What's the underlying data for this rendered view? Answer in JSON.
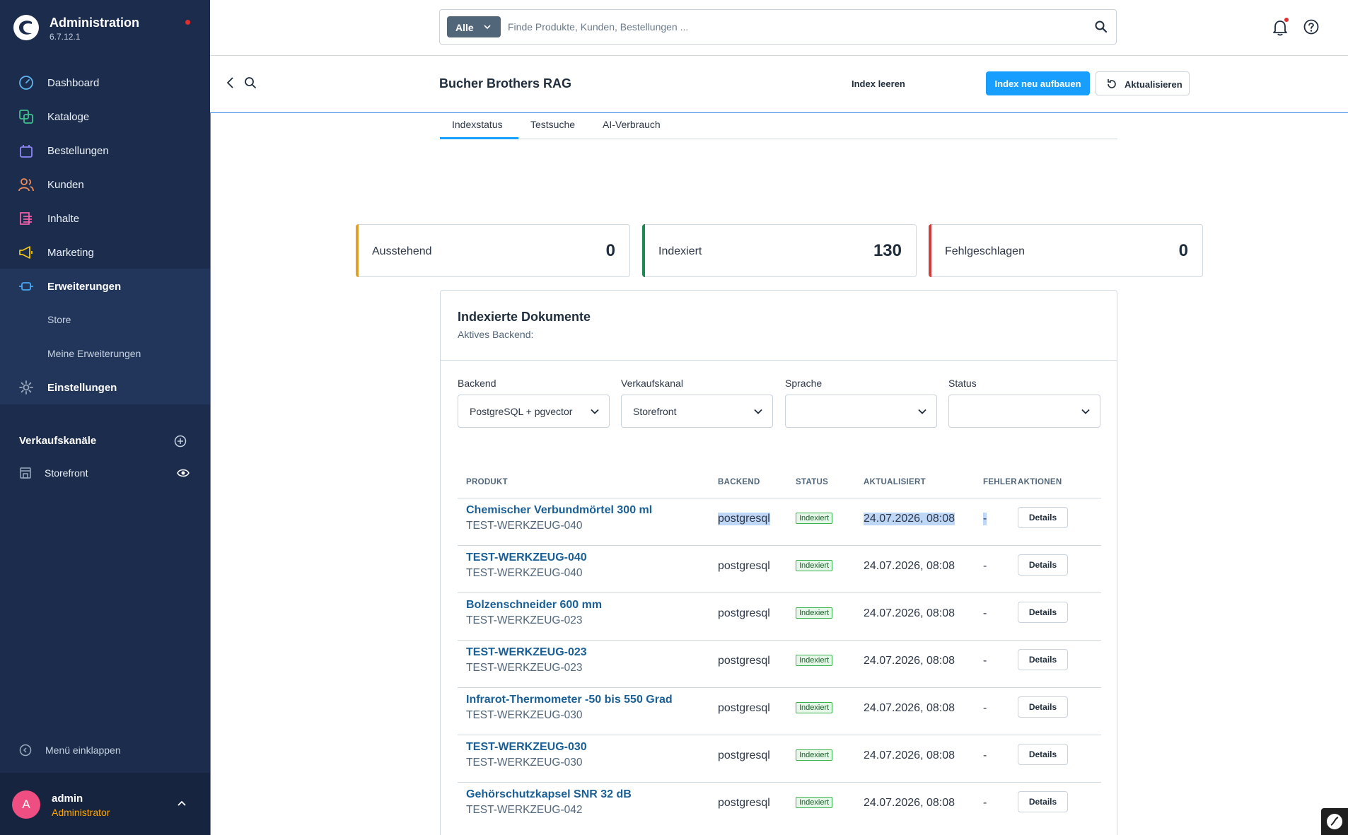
{
  "brand": {
    "title": "Administration",
    "version": "6.7.12.1"
  },
  "nav": {
    "items": [
      {
        "label": "Dashboard",
        "icon": "gauge-icon"
      },
      {
        "label": "Kataloge",
        "icon": "catalog-icon"
      },
      {
        "label": "Bestellungen",
        "icon": "shopping-bag-icon"
      },
      {
        "label": "Kunden",
        "icon": "users-icon"
      },
      {
        "label": "Inhalte",
        "icon": "content-icon"
      },
      {
        "label": "Marketing",
        "icon": "megaphone-icon"
      },
      {
        "label": "Erweiterungen",
        "icon": "plug-icon"
      },
      {
        "label": "Einstellungen",
        "icon": "gear-icon"
      }
    ],
    "sub_items": [
      "Store",
      "Meine Erweiterungen"
    ]
  },
  "sales_channels": {
    "title": "Verkaufskanäle",
    "items": [
      {
        "label": "Storefront"
      }
    ]
  },
  "collapse_label": "Menü einklappen",
  "user": {
    "initial": "A",
    "name": "admin",
    "role": "Administrator"
  },
  "search": {
    "type_label": "Alle",
    "placeholder": "Finde Produkte, Kunden, Bestellungen ..."
  },
  "page": {
    "title": "Bucher Brothers RAG",
    "buttons": {
      "clear": "Index leeren",
      "rebuild": "Index neu aufbauen",
      "refresh": "Aktualisieren"
    }
  },
  "tabs": [
    "Indexstatus",
    "Testsuche",
    "AI-Verbrauch"
  ],
  "stats": [
    {
      "label": "Ausstehend",
      "value": "0",
      "color": "#e0a029"
    },
    {
      "label": "Indexiert",
      "value": "130",
      "color": "#1d8a55"
    },
    {
      "label": "Fehlgeschlagen",
      "value": "0",
      "color": "#d63b3b"
    }
  ],
  "card": {
    "title": "Indexierte Dokumente",
    "subtitle": "Aktives Backend:",
    "filters": [
      {
        "label": "Backend",
        "value": "PostgreSQL + pgvector"
      },
      {
        "label": "Verkaufskanal",
        "value": "Storefront"
      },
      {
        "label": "Sprache",
        "value": ""
      },
      {
        "label": "Status",
        "value": ""
      }
    ],
    "columns": [
      "PRODUKT",
      "BACKEND",
      "STATUS",
      "AKTUALISIERT",
      "FEHLER",
      "AKTIONEN"
    ],
    "rows": [
      {
        "product": "Chemischer Verbundmörtel 300 ml",
        "sku": "TEST-WERKZEUG-040",
        "backend": "postgresql",
        "status": "Indexiert",
        "updated": "24.07.2026, 08:08",
        "error": "-",
        "action": "Details"
      },
      {
        "product": "TEST-WERKZEUG-040",
        "sku": "TEST-WERKZEUG-040",
        "backend": "postgresql",
        "status": "Indexiert",
        "updated": "24.07.2026, 08:08",
        "error": "-",
        "action": "Details"
      },
      {
        "product": "Bolzenschneider 600 mm",
        "sku": "TEST-WERKZEUG-023",
        "backend": "postgresql",
        "status": "Indexiert",
        "updated": "24.07.2026, 08:08",
        "error": "-",
        "action": "Details"
      },
      {
        "product": "TEST-WERKZEUG-023",
        "sku": "TEST-WERKZEUG-023",
        "backend": "postgresql",
        "status": "Indexiert",
        "updated": "24.07.2026, 08:08",
        "error": "-",
        "action": "Details"
      },
      {
        "product": "Infrarot-Thermometer -50 bis 550 Grad",
        "sku": "TEST-WERKZEUG-030",
        "backend": "postgresql",
        "status": "Indexiert",
        "updated": "24.07.2026, 08:08",
        "error": "-",
        "action": "Details"
      },
      {
        "product": "TEST-WERKZEUG-030",
        "sku": "TEST-WERKZEUG-030",
        "backend": "postgresql",
        "status": "Indexiert",
        "updated": "24.07.2026, 08:08",
        "error": "-",
        "action": "Details"
      },
      {
        "product": "Gehörschutzkapsel SNR 32 dB",
        "sku": "TEST-WERKZEUG-042",
        "backend": "postgresql",
        "status": "Indexiert",
        "updated": "24.07.2026, 08:08",
        "error": "-",
        "action": "Details"
      }
    ]
  }
}
